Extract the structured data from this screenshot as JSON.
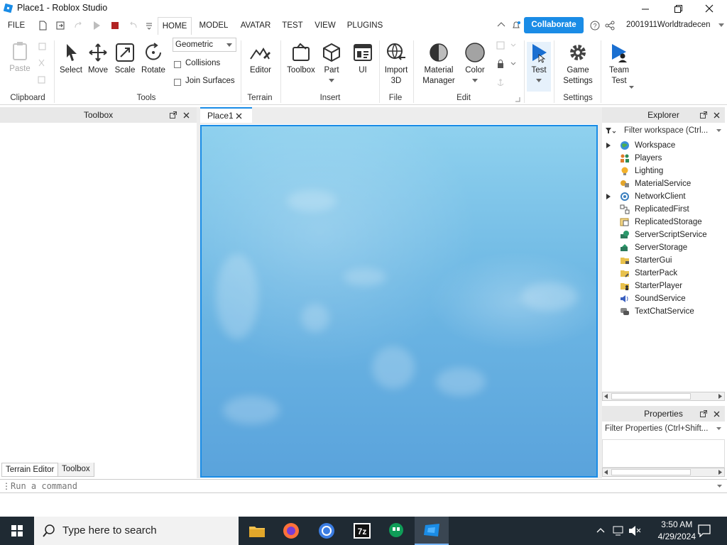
{
  "window": {
    "title": "Place1 - Roblox Studio"
  },
  "menu": {
    "file": "FILE",
    "tabs": [
      "HOME",
      "MODEL",
      "AVATAR",
      "TEST",
      "VIEW",
      "PLUGINS"
    ],
    "collaborate": "Collaborate",
    "username": "2001911Worldtradecen"
  },
  "ribbon": {
    "clipboard": {
      "paste": "Paste",
      "group": "Clipboard"
    },
    "tools": {
      "select": "Select",
      "move": "Move",
      "scale": "Scale",
      "rotate": "Rotate",
      "group": "Tools",
      "mode": "Geometric",
      "collisions": "Collisions",
      "join_surfaces": "Join Surfaces"
    },
    "terrain": {
      "editor": "Editor",
      "group": "Terrain"
    },
    "insert": {
      "toolbox": "Toolbox",
      "part": "Part",
      "ui": "UI",
      "group": "Insert"
    },
    "file": {
      "import3d_1": "Import",
      "import3d_2": "3D",
      "group": "File"
    },
    "edit": {
      "material_1": "Material",
      "material_2": "Manager",
      "color": "Color",
      "group": "Edit"
    },
    "test": {
      "test": "Test"
    },
    "settings": {
      "game_1": "Game",
      "game_2": "Settings",
      "group": "Settings"
    },
    "team": {
      "team_1": "Team",
      "team_2": "Test"
    }
  },
  "toolbox_panel": {
    "title": "Toolbox",
    "tab_terrain": "Terrain Editor",
    "tab_toolbox": "Toolbox"
  },
  "document": {
    "tab": "Place1"
  },
  "explorer": {
    "title": "Explorer",
    "filter": "Filter workspace (Ctrl...",
    "items": [
      {
        "label": "Workspace",
        "icon": "globe-icon",
        "expandable": true
      },
      {
        "label": "Players",
        "icon": "players-icon",
        "expandable": false
      },
      {
        "label": "Lighting",
        "icon": "lightbulb-icon",
        "expandable": false
      },
      {
        "label": "MaterialService",
        "icon": "material-service-icon",
        "expandable": false
      },
      {
        "label": "NetworkClient",
        "icon": "network-icon",
        "expandable": true
      },
      {
        "label": "ReplicatedFirst",
        "icon": "replicated-first-icon",
        "expandable": false
      },
      {
        "label": "ReplicatedStorage",
        "icon": "replicated-storage-icon",
        "expandable": false
      },
      {
        "label": "ServerScriptService",
        "icon": "server-script-icon",
        "expandable": false
      },
      {
        "label": "ServerStorage",
        "icon": "server-storage-icon",
        "expandable": false
      },
      {
        "label": "StarterGui",
        "icon": "starter-gui-icon",
        "expandable": false
      },
      {
        "label": "StarterPack",
        "icon": "starter-pack-icon",
        "expandable": false
      },
      {
        "label": "StarterPlayer",
        "icon": "starter-player-icon",
        "expandable": false
      },
      {
        "label": "SoundService",
        "icon": "sound-icon",
        "expandable": false
      },
      {
        "label": "TextChatService",
        "icon": "chat-icon",
        "expandable": false
      }
    ]
  },
  "properties": {
    "title": "Properties",
    "filter": "Filter Properties (Ctrl+Shift..."
  },
  "command": {
    "placeholder": "Run a command"
  },
  "taskbar": {
    "search": "Type here to search",
    "time": "3:50 AM",
    "date": "4/29/2024"
  },
  "colors": {
    "accent": "#1a8ce6",
    "sky": "#6eb8e4",
    "taskbar": "#1f2a33"
  }
}
